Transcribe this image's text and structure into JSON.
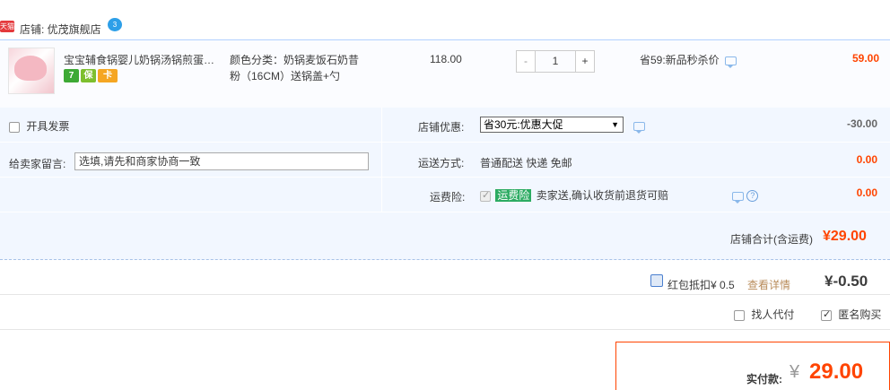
{
  "shop": {
    "badge": "天猫",
    "label": "店铺: 优茂旗舰店",
    "chat_badge": "3"
  },
  "item": {
    "title": "宝宝辅食锅婴儿奶锅汤锅煎蛋锅多功能",
    "badges": [
      "7",
      "保",
      "卡"
    ],
    "sku": "颜色分类：奶锅麦饭石奶昔粉（16CM）送锅盖+勺",
    "price": "118.00",
    "qty_minus": "-",
    "qty": "1",
    "qty_plus": "+",
    "promo": "省59:新品秒杀价",
    "total": "59.00"
  },
  "options": {
    "invoice_label": "开具发票",
    "message_label": "给卖家留言:",
    "message_placeholder": "选填,请先和商家协商一致",
    "coupon_label": "店铺优惠:",
    "coupon_selected": "省30元:优惠大促",
    "coupon_amount": "-30.00",
    "shipping_label": "运送方式:",
    "shipping_value": "普通配送 快递 免邮",
    "shipping_amount": "0.00",
    "insurance_label": "运费险:",
    "insurance_tag": "运费险",
    "insurance_text": "卖家送,确认收货前退货可赔",
    "insurance_amount": "0.00",
    "shop_total_label": "店铺合计(含运费)",
    "shop_total": "¥29.00"
  },
  "redpacket": {
    "label": "红包抵扣¥ 0.5",
    "detail_link": "查看详情",
    "value": "¥-0.50"
  },
  "extras": {
    "proxy_label": "找人代付",
    "anon_label": "匿名购买"
  },
  "payment": {
    "label": "实付款:",
    "yen": "¥",
    "value": "29.00"
  },
  "colors": {
    "accent": "#ff4400",
    "row_bg": "#f2f7ff",
    "border_blue": "#b2d1ff"
  }
}
